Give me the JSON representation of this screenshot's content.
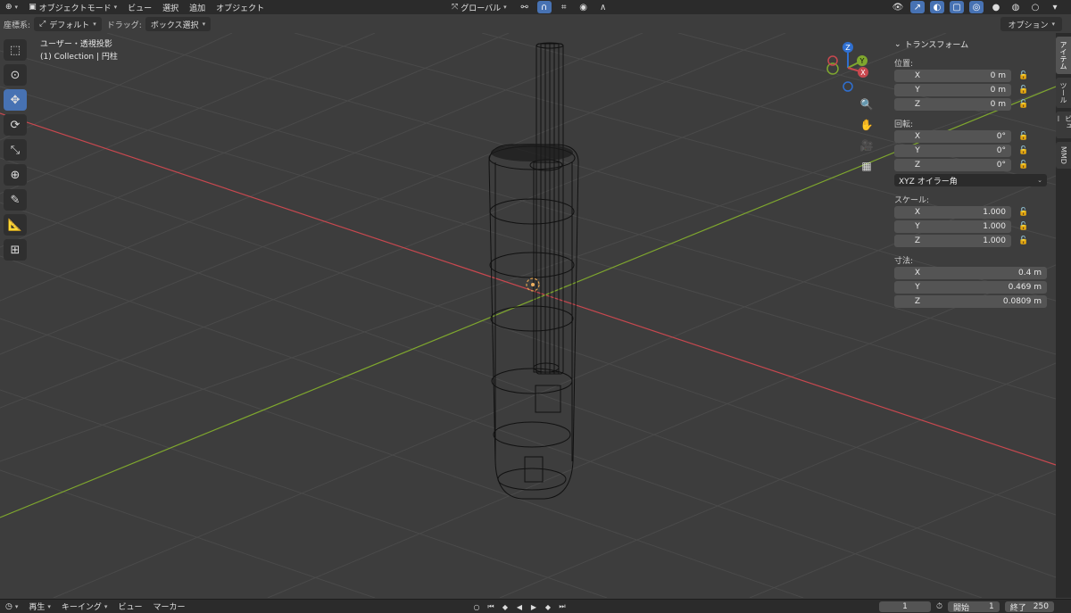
{
  "header": {
    "editor_icon": "view3d-icon",
    "mode": "オブジェクトモード",
    "menus": [
      "ビュー",
      "選択",
      "追加",
      "オブジェクト"
    ],
    "orientation": "グローバル"
  },
  "toolbar": {
    "coord_label": "座標系:",
    "coord_value": "デフォルト",
    "drag_label": "ドラッグ:",
    "drag_value": "ボックス選択",
    "options": "オプション"
  },
  "viewport": {
    "view_name": "ユーザー・透視投影",
    "collection": "(1) Collection | 円柱",
    "gizmo": {
      "x": "X",
      "y": "Y",
      "z": "Z"
    }
  },
  "tools": [
    "select-box-icon",
    "cursor-icon",
    "move-icon",
    "rotate-icon",
    "scale-icon",
    "transform-icon",
    "annotate-icon",
    "measure-icon",
    "add-cube-icon"
  ],
  "transform": {
    "title": "トランスフォーム",
    "location_label": "位置:",
    "location": [
      {
        "k": "X",
        "v": "0 m"
      },
      {
        "k": "Y",
        "v": "0 m"
      },
      {
        "k": "Z",
        "v": "0 m"
      }
    ],
    "rotation_label": "回転:",
    "rotation": [
      {
        "k": "X",
        "v": "0°"
      },
      {
        "k": "Y",
        "v": "0°"
      },
      {
        "k": "Z",
        "v": "0°"
      }
    ],
    "rotation_mode": "XYZ オイラー角",
    "scale_label": "スケール:",
    "scale": [
      {
        "k": "X",
        "v": "1.000"
      },
      {
        "k": "Y",
        "v": "1.000"
      },
      {
        "k": "Z",
        "v": "1.000"
      }
    ],
    "dimensions_label": "寸法:",
    "dimensions": [
      {
        "k": "X",
        "v": "0.4 m"
      },
      {
        "k": "Y",
        "v": "0.469 m"
      },
      {
        "k": "Z",
        "v": "0.0809 m"
      }
    ]
  },
  "side_tabs": [
    "アイテム",
    "ツール",
    "ビュー",
    "MMD"
  ],
  "timeline": {
    "menus": [
      "再生",
      "キーイング",
      "ビュー",
      "マーカー"
    ],
    "current_frame": "1",
    "start_label": "開始",
    "start": "1",
    "end_label": "終了",
    "end": "250"
  },
  "colors": {
    "accent": "#4772b3",
    "x_axis": "#c8484f",
    "y_axis": "#7fa72e"
  }
}
